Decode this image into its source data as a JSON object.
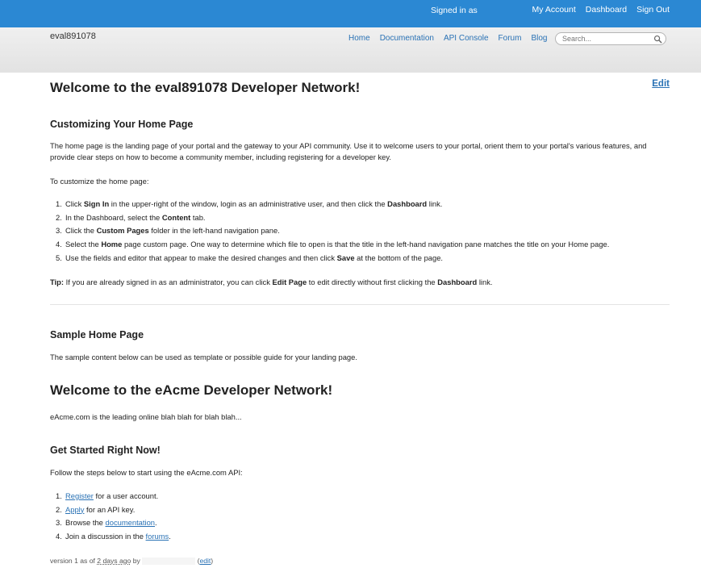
{
  "topbar": {
    "signed_in": "Signed in as",
    "my_account": "My Account",
    "dashboard": "Dashboard",
    "sign_out": "Sign Out"
  },
  "header": {
    "site_name": "eval891078",
    "nav": [
      "Home",
      "Documentation",
      "API Console",
      "Forum",
      "Blog"
    ],
    "search_placeholder": "Search..."
  },
  "page": {
    "title": "Welcome to the eval891078 Developer Network!",
    "edit_label": "Edit",
    "customizing": {
      "heading": "Customizing Your Home Page",
      "intro": "The home page is the landing page of your portal and the gateway to your API community. Use it to welcome users to your portal, orient them to your portal's various features, and provide clear steps on how to become a community member, including registering for a developer key.",
      "to_customize": "To customize the home page:",
      "steps": [
        {
          "n": "1.",
          "a": "Click ",
          "b": "Sign In",
          "c": " in the upper-right of the window, login as an administrative user, and then click the ",
          "d": "Dashboard",
          "e": " link."
        },
        {
          "n": "2.",
          "a": "In the Dashboard, select the ",
          "b": "Content",
          "c": " tab.",
          "d": "",
          "e": ""
        },
        {
          "n": "3.",
          "a": "Click the ",
          "b": "Custom Pages",
          "c": " folder in the left-hand navigation pane.",
          "d": "",
          "e": ""
        },
        {
          "n": "4.",
          "a": "Select the ",
          "b": "Home",
          "c": " page custom page. One way to determine which file to open is that the title in the left-hand navigation pane matches the title on your Home page.",
          "d": "",
          "e": ""
        },
        {
          "n": "5.",
          "a": "Use the fields and editor that appear to make the desired changes and then click ",
          "b": "Save",
          "c": " at the bottom of the page.",
          "d": "",
          "e": ""
        }
      ],
      "tip_label": "Tip:",
      "tip_a": " If you are already signed in as an administrator, you can click ",
      "tip_b": "Edit Page",
      "tip_c": " to edit directly without first clicking the ",
      "tip_d": "Dashboard",
      "tip_e": " link."
    },
    "sample": {
      "heading": "Sample Home Page",
      "text": "The sample content below can be used as template or possible guide for your landing page."
    },
    "acme": {
      "title": "Welcome to the eAcme Developer Network!",
      "tagline": "eAcme.com is the leading online blah blah for blah blah...",
      "get_started": "Get Started Right Now!",
      "follow": "Follow the steps below to start using the eAcme.com API:",
      "steps": [
        {
          "n": "1.",
          "link": "Register",
          "pre": "",
          "post": " for a user account."
        },
        {
          "n": "2.",
          "link": "Apply",
          "pre": "",
          "post": " for an API key."
        },
        {
          "n": "3.",
          "link": "documentation",
          "pre": "Browse the ",
          "post": "."
        },
        {
          "n": "4.",
          "link": "forums",
          "pre": "Join a discussion in the ",
          "post": "."
        }
      ]
    },
    "footer": {
      "version_prefix": "version 1 as of ",
      "time_ago": "2 days ago",
      "by": " by",
      "edit": "edit"
    }
  }
}
